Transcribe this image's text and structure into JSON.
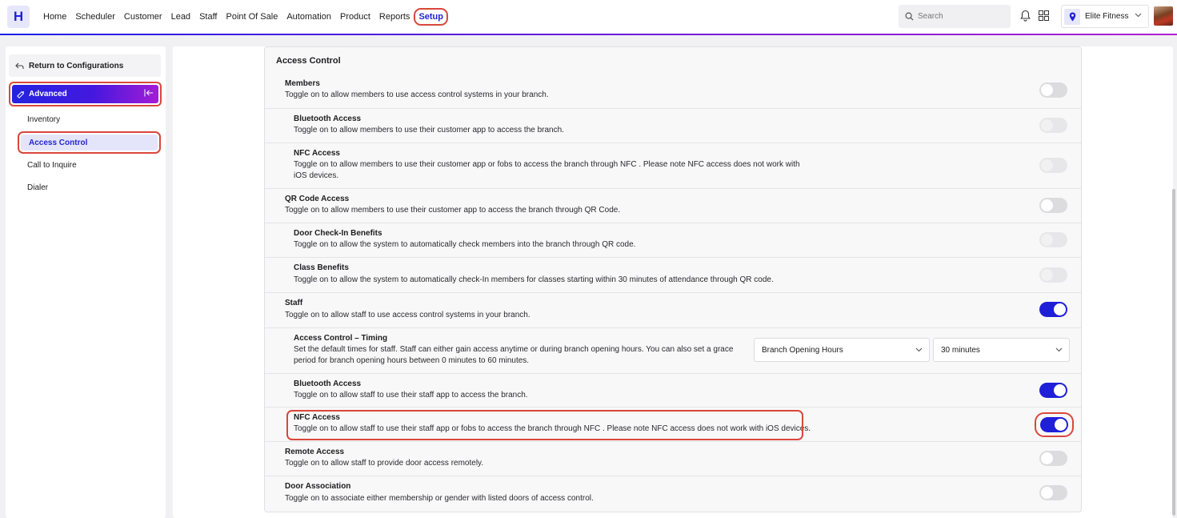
{
  "app": {
    "logo": "H"
  },
  "nav": {
    "items": [
      "Home",
      "Scheduler",
      "Customer",
      "Lead",
      "Staff",
      "Point Of Sale",
      "Automation",
      "Product",
      "Reports"
    ],
    "active": "Setup"
  },
  "search": {
    "placeholder": "Search"
  },
  "branch": {
    "name": "Elite Fitness"
  },
  "sidebar": {
    "return_label": "Return to Configurations",
    "section": "Advanced",
    "items": [
      "Inventory",
      "Access Control",
      "Call to Inquire",
      "Dialer"
    ]
  },
  "panel": {
    "title": "Access Control",
    "rows": [
      {
        "title": "Members",
        "desc": "Toggle on to allow members to use access control systems in your branch.",
        "state": "off"
      },
      {
        "title": "Bluetooth Access",
        "desc": "Toggle on to allow members to use their customer app to access the branch.",
        "state": "disabled"
      },
      {
        "title": "NFC Access",
        "desc": "Toggle on to allow members to use their customer app or fobs to access the branch through NFC . Please note NFC access does not work with iOS devices.",
        "state": "disabled"
      },
      {
        "title": "QR Code Access",
        "desc": "Toggle on to allow members to use their customer app to access the branch through QR Code.",
        "state": "off"
      },
      {
        "title": "Door Check-In Benefits",
        "desc": "Toggle on to allow the system to automatically check members into the branch through QR code.",
        "state": "disabled"
      },
      {
        "title": "Class Benefits",
        "desc": "Toggle on to allow the system to automatically check-In members for classes starting within 30 minutes of attendance through QR code.",
        "state": "disabled"
      },
      {
        "title": "Staff",
        "desc": "Toggle on to allow staff to use access control systems in your branch.",
        "state": "on"
      },
      {
        "title": "Access Control – Timing",
        "desc": "Set the default times for staff. Staff can either gain access anytime or during branch opening hours. You can also set a grace period for branch opening hours between 0 minutes to 60 minutes.",
        "select1": "Branch Opening Hours",
        "select2": "30 minutes"
      },
      {
        "title": "Bluetooth Access",
        "desc": "Toggle on to allow staff to use their staff app to access the branch.",
        "state": "on"
      },
      {
        "title": "NFC Access",
        "desc": "Toggle on to allow staff to use their staff app or fobs to access the branch through NFC . Please note NFC access does not work with iOS devices.",
        "state": "on"
      },
      {
        "title": "Remote Access",
        "desc": "Toggle on to allow staff to provide door access remotely.",
        "state": "off"
      },
      {
        "title": "Door Association",
        "desc": "Toggle on to associate either membership or gender with listed doors of access control.",
        "state": "off"
      }
    ]
  },
  "colors": {
    "accent": "#2323d6",
    "highlight": "#d9473c",
    "toggle_on": "#1f1fd8"
  }
}
